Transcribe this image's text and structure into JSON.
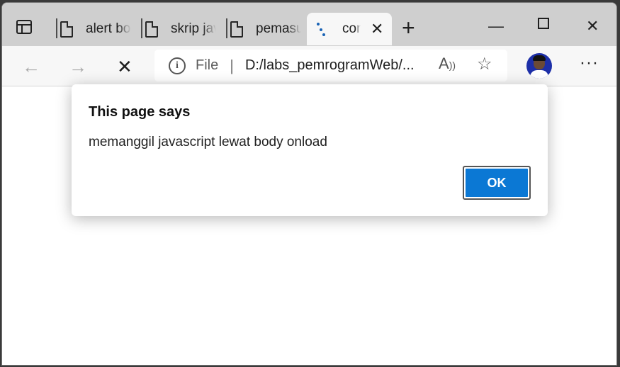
{
  "tabs": [
    {
      "title": "alert body onload"
    },
    {
      "title": "skrip javascript"
    },
    {
      "title": "pemasukan"
    },
    {
      "title": "contoh"
    }
  ],
  "toolbar": {
    "file_label": "File",
    "separator": "|",
    "url": "D:/labs_pemrogramWeb/..."
  },
  "dialog": {
    "title": "This page says",
    "message": "memanggil javascript lewat body onload",
    "ok_label": "OK"
  },
  "icons": {
    "tab_actions": "tab-actions-icon",
    "document": "document-icon",
    "loading": "loading-spinner-icon",
    "close": "close-icon",
    "new_tab": "plus-icon",
    "minimize": "minimize-icon",
    "maximize": "maximize-icon",
    "window_close": "close-icon",
    "back": "back-arrow-icon",
    "forward": "forward-arrow-icon",
    "stop": "stop-icon",
    "info": "info-icon",
    "read_aloud": "read-aloud-icon",
    "favorites": "favorite-add-icon",
    "more": "more-icon"
  },
  "colors": {
    "accent": "#0b78d4",
    "spinner": "#1a63b5"
  }
}
